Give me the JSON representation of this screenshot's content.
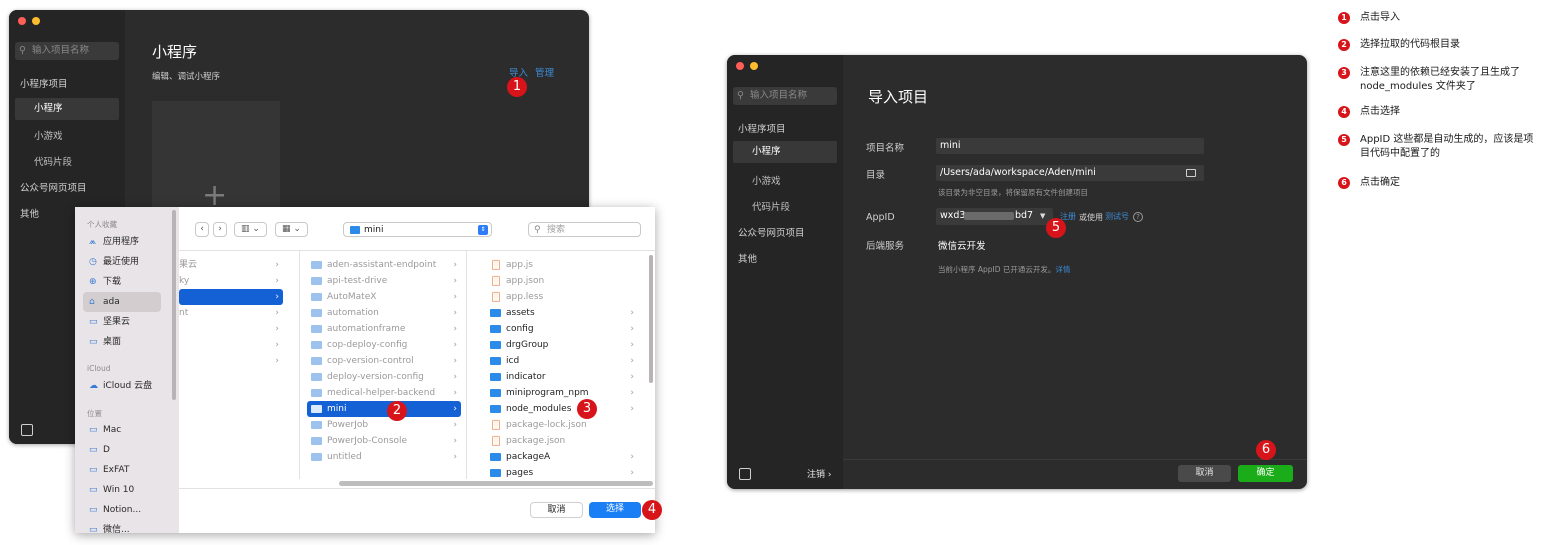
{
  "window_a": {
    "search_placeholder": "输入项目名称",
    "nav": {
      "miniprogram_projects": "小程序项目",
      "miniprogram": "小程序",
      "minigame": "小游戏",
      "code_snippet": "代码片段",
      "web_projects": "公众号网页项目",
      "other": "其他"
    },
    "title": "小程序",
    "subtitle": "编辑、调试小程序",
    "import_link": "导入",
    "manage_link": "管理",
    "add_glyph": "+",
    "badge": "1"
  },
  "dialog": {
    "sidebar": {
      "favorites_header": "个人收藏",
      "favorites": [
        {
          "icon": "apps-icon",
          "glyph": "⩕",
          "label": "应用程序"
        },
        {
          "icon": "recents-icon",
          "glyph": "◷",
          "label": "最近使用"
        },
        {
          "icon": "download-icon",
          "glyph": "⊕",
          "label": "下载"
        },
        {
          "icon": "home-icon",
          "glyph": "⌂",
          "label": "ada"
        },
        {
          "icon": "folder-icon",
          "glyph": "▭",
          "label": "坚果云"
        },
        {
          "icon": "desktop-icon",
          "glyph": "▭",
          "label": "桌面"
        }
      ],
      "icloud_header": "iCloud",
      "icloud": [
        {
          "icon": "cloud-icon",
          "glyph": "☁",
          "label": "iCloud 云盘"
        }
      ],
      "locations_header": "位置",
      "locations": [
        {
          "icon": "computer-icon",
          "glyph": "▭",
          "label": "Mac"
        },
        {
          "icon": "disk-icon",
          "glyph": "▭",
          "label": "D"
        },
        {
          "icon": "disk-icon",
          "glyph": "▭",
          "label": "ExFAT"
        },
        {
          "icon": "disk-icon",
          "glyph": "▭",
          "label": "Win 10"
        },
        {
          "icon": "disk-icon",
          "glyph": "▭",
          "label": "Notion..."
        },
        {
          "icon": "disk-icon",
          "glyph": "▭",
          "label": "微信..."
        }
      ]
    },
    "toolbar": {
      "back": "‹",
      "forward": "›",
      "view_columns": "▥ ⌄",
      "view_grid": "▦ ⌄",
      "path": "mini",
      "search_placeholder": "搜索"
    },
    "col0": [
      "果云",
      "ky",
      "",
      "nt",
      "",
      "",
      ""
    ],
    "col1": [
      "aden-assistant-endpoint",
      "api-test-drive",
      "AutoMateX",
      "automation",
      "automationframe",
      "cop-deploy-config",
      "cop-version-control",
      "deploy-version-config",
      "medical-helper-backend",
      "mini",
      "PowerJob",
      "PowerJob-Console",
      "untitled"
    ],
    "col2": [
      "app.js",
      "app.json",
      "app.less",
      "assets",
      "config",
      "drgGroup",
      "icd",
      "indicator",
      "miniprogram_npm",
      "node_modules",
      "package-lock.json",
      "package.json",
      "packageA",
      "pages"
    ],
    "cancel": "取消",
    "choose": "选择",
    "badges": {
      "select_dir": "2",
      "node_modules": "3",
      "choose": "4"
    }
  },
  "window_b": {
    "search_placeholder": "输入项目名称",
    "nav": {
      "miniprogram_projects": "小程序项目",
      "miniprogram": "小程序",
      "minigame": "小游戏",
      "code_snippet": "代码片段",
      "web_projects": "公众号网页项目",
      "other": "其他"
    },
    "title": "导入项目",
    "form": {
      "name_label": "项目名称",
      "name_value": "mini",
      "dir_label": "目录",
      "dir_value": "/Users/ada/workspace/Aden/mini",
      "dir_hint": "该目录为非空目录，将保留原有文件创建项目",
      "appid_label": "AppID",
      "appid_prefix": "wxd3",
      "appid_suffix": "bd7",
      "register": "注册",
      "or_use": "或使用",
      "test_account": "测试号",
      "help_glyph": "?",
      "backend_label": "后端服务",
      "backend_value": "微信云开发",
      "backend_hint": "当前小程序 AppID 已开通云开发。",
      "details": "详情"
    },
    "logout": "注销 ›",
    "cancel": "取消",
    "confirm": "确定",
    "badges": {
      "appid": "5",
      "confirm": "6"
    }
  },
  "notes": [
    {
      "num": "1",
      "text": "点击导入"
    },
    {
      "num": "2",
      "text": "选择拉取的代码根目录"
    },
    {
      "num": "3",
      "text": "注意这里的依赖已经安装了且生成了node_modules 文件夹了"
    },
    {
      "num": "4",
      "text": "点击选择"
    },
    {
      "num": "5",
      "text": "AppID 这些都是自动生成的，应该是项目代码中配置了的"
    },
    {
      "num": "6",
      "text": "点击确定"
    }
  ]
}
